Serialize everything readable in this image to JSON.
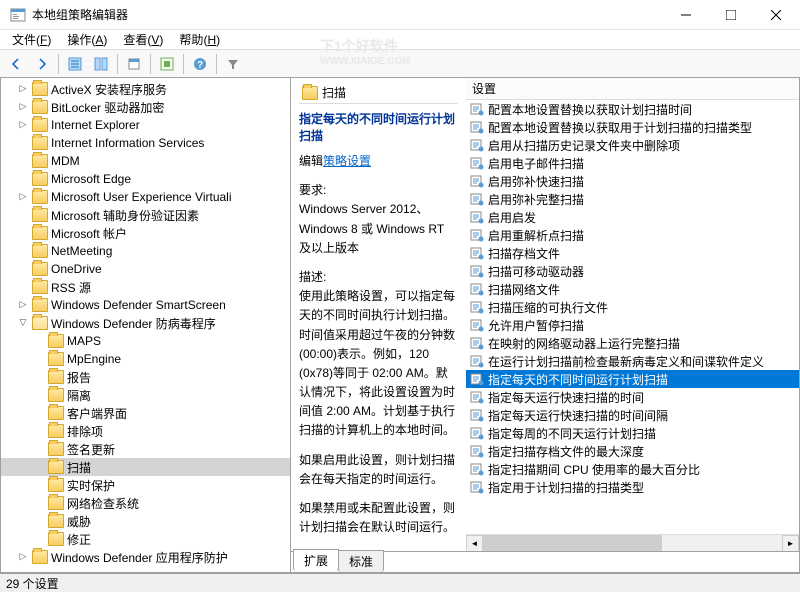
{
  "titlebar": {
    "title": "本地组策略编辑器"
  },
  "watermark": {
    "line1": "下1个好软件",
    "line2": "WWW.XIAIGE.COM"
  },
  "menubar": {
    "file": "文件",
    "file_u": "F",
    "action": "操作",
    "action_u": "A",
    "view": "查看",
    "view_u": "V",
    "help": "帮助",
    "help_u": "H"
  },
  "tree": {
    "items": [
      {
        "label": "ActiveX 安装程序服务",
        "indent": 4,
        "toggle": ">"
      },
      {
        "label": "BitLocker 驱动器加密",
        "indent": 4,
        "toggle": ">"
      },
      {
        "label": "Internet Explorer",
        "indent": 4,
        "toggle": ">"
      },
      {
        "label": "Internet Information Services",
        "indent": 4,
        "toggle": ""
      },
      {
        "label": "MDM",
        "indent": 4,
        "toggle": ""
      },
      {
        "label": "Microsoft Edge",
        "indent": 4,
        "toggle": ""
      },
      {
        "label": "Microsoft User Experience Virtuali",
        "indent": 4,
        "toggle": ">"
      },
      {
        "label": "Microsoft 辅助身份验证因素",
        "indent": 4,
        "toggle": ""
      },
      {
        "label": "Microsoft 帐户",
        "indent": 4,
        "toggle": ""
      },
      {
        "label": "NetMeeting",
        "indent": 4,
        "toggle": ""
      },
      {
        "label": "OneDrive",
        "indent": 4,
        "toggle": ""
      },
      {
        "label": "RSS 源",
        "indent": 4,
        "toggle": ""
      },
      {
        "label": "Windows Defender SmartScreen",
        "indent": 4,
        "toggle": ">"
      },
      {
        "label": "Windows Defender 防病毒程序",
        "indent": 4,
        "toggle": "v",
        "open": true
      },
      {
        "label": "MAPS",
        "indent": 5,
        "toggle": ""
      },
      {
        "label": "MpEngine",
        "indent": 5,
        "toggle": ""
      },
      {
        "label": "报告",
        "indent": 5,
        "toggle": ""
      },
      {
        "label": "隔离",
        "indent": 5,
        "toggle": ""
      },
      {
        "label": "客户端界面",
        "indent": 5,
        "toggle": ""
      },
      {
        "label": "排除项",
        "indent": 5,
        "toggle": ""
      },
      {
        "label": "签名更新",
        "indent": 5,
        "toggle": ""
      },
      {
        "label": "扫描",
        "indent": 5,
        "toggle": "",
        "selected": true
      },
      {
        "label": "实时保护",
        "indent": 5,
        "toggle": ""
      },
      {
        "label": "网络检查系统",
        "indent": 5,
        "toggle": ""
      },
      {
        "label": "威胁",
        "indent": 5,
        "toggle": ""
      },
      {
        "label": "修正",
        "indent": 5,
        "toggle": ""
      },
      {
        "label": "Windows Defender 应用程序防护",
        "indent": 4,
        "toggle": ">"
      }
    ]
  },
  "detail": {
    "header": "扫描",
    "title": "指定每天的不同时间运行计划扫描",
    "edit_label": "编辑",
    "edit_link": "策略设置",
    "req_label": "要求:",
    "req_text": "Windows Server 2012、Windows 8 或 Windows RT 及以上版本",
    "desc_label": "描述:",
    "desc_text": "使用此策略设置，可以指定每天的不同时间执行计划扫描。时间值采用超过午夜的分钟数(00:00)表示。例如，120 (0x78)等同于 02:00 AM。默认情况下，将此设置设置为时间值 2:00 AM。计划基于执行扫描的计算机上的本地时间。",
    "p2": "如果启用此设置，则计划扫描会在每天指定的时间运行。",
    "p3": "如果禁用或未配置此设置，则计划扫描会在默认时间运行。"
  },
  "settings": {
    "header": "设置",
    "items": [
      "配置本地设置替换以获取计划扫描时间",
      "配置本地设置替换以获取用于计划扫描的扫描类型",
      "启用从扫描历史记录文件夹中删除项",
      "启用电子邮件扫描",
      "启用弥补快速扫描",
      "启用弥补完整扫描",
      "启用启发",
      "启用重解析点扫描",
      "扫描存档文件",
      "扫描可移动驱动器",
      "扫描网络文件",
      "扫描压缩的可执行文件",
      "允许用户暂停扫描",
      "在映射的网络驱动器上运行完整扫描",
      "在运行计划扫描前检查最新病毒定义和间谍软件定义",
      "指定每天的不同时间运行计划扫描",
      "指定每天运行快速扫描的时间",
      "指定每天运行快速扫描的时间间隔",
      "指定每周的不同天运行计划扫描",
      "指定扫描存档文件的最大深度",
      "指定扫描期间 CPU 使用率的最大百分比",
      "指定用于计划扫描的扫描类型"
    ],
    "selected_index": 15
  },
  "tabs": {
    "extended": "扩展",
    "standard": "标准"
  },
  "statusbar": {
    "text": "29 个设置"
  }
}
